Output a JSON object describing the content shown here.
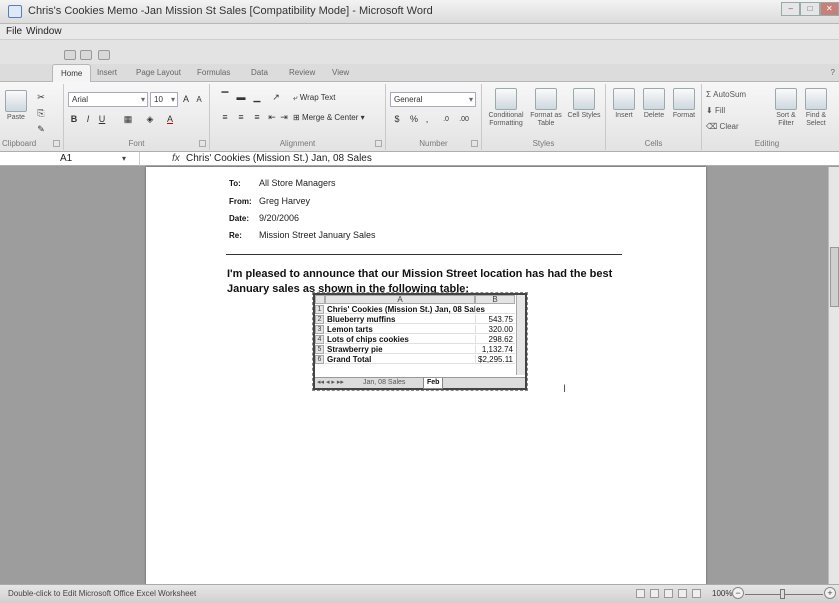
{
  "window": {
    "title": "Chris's Cookies Memo -Jan Mission St Sales [Compatibility Mode] - Microsoft Word"
  },
  "menu": [
    "File",
    "Window"
  ],
  "tabs": [
    "Home",
    "Insert",
    "Page Layout",
    "Formulas",
    "Data",
    "Review",
    "View"
  ],
  "ribbon": {
    "clipboard": {
      "paste": "Paste",
      "label": "Clipboard"
    },
    "font": {
      "name": "Arial",
      "size": "10",
      "label": "Font",
      "bold": "B",
      "italic": "I",
      "underline": "U"
    },
    "alignment": {
      "wrap": "Wrap Text",
      "merge": "Merge & Center",
      "label": "Alignment"
    },
    "number": {
      "format": "General",
      "currency": "$",
      "percent": "%",
      "comma": ",",
      "label": "Number"
    },
    "styles": {
      "conditional": "Conditional Formatting",
      "format_table": "Format as Table",
      "cell_styles": "Cell Styles",
      "label": "Styles"
    },
    "cells": {
      "insert": "Insert",
      "delete": "Delete",
      "format": "Format",
      "label": "Cells"
    },
    "editing": {
      "autosum": "AutoSum",
      "fill": "Fill",
      "clear": "Clear",
      "sort": "Sort & Filter",
      "find": "Find & Select",
      "label": "Editing"
    }
  },
  "formula_bar": {
    "name_box": "A1",
    "fx": "fx",
    "formula": "Chris' Cookies (Mission St.) Jan, 08 Sales"
  },
  "memo": {
    "to_label": "To:",
    "to": "All Store Managers",
    "from_label": "From:",
    "from": "Greg Harvey",
    "date_label": "Date:",
    "date": "9/20/2006",
    "re_label": "Re:",
    "re": "Mission Street January Sales",
    "line1": "I'm pleased to announce that our Mission Street location has had the best",
    "line2": "January sales as shown in the following table:"
  },
  "embedded_sheet": {
    "columns": [
      "A",
      "B"
    ],
    "rows": [
      {
        "num": "1",
        "a": "Chris' Cookies (Mission St.) Jan, 08 Sales",
        "b": ""
      },
      {
        "num": "2",
        "a": "Blueberry muffins",
        "b": "543.75"
      },
      {
        "num": "3",
        "a": "Lemon tarts",
        "b": "320.00"
      },
      {
        "num": "4",
        "a": "Lots of chips cookies",
        "b": "298.62"
      },
      {
        "num": "5",
        "a": "Strawberry pie",
        "b": "1,132.74"
      },
      {
        "num": "6",
        "a": "Grand Total",
        "b": "$2,295.11"
      }
    ],
    "sheet_tabs": [
      "Jan, 08 Sales",
      "Feb"
    ]
  },
  "status": {
    "text": "Double-click to Edit Microsoft Office Excel Worksheet",
    "zoom": "100%"
  }
}
